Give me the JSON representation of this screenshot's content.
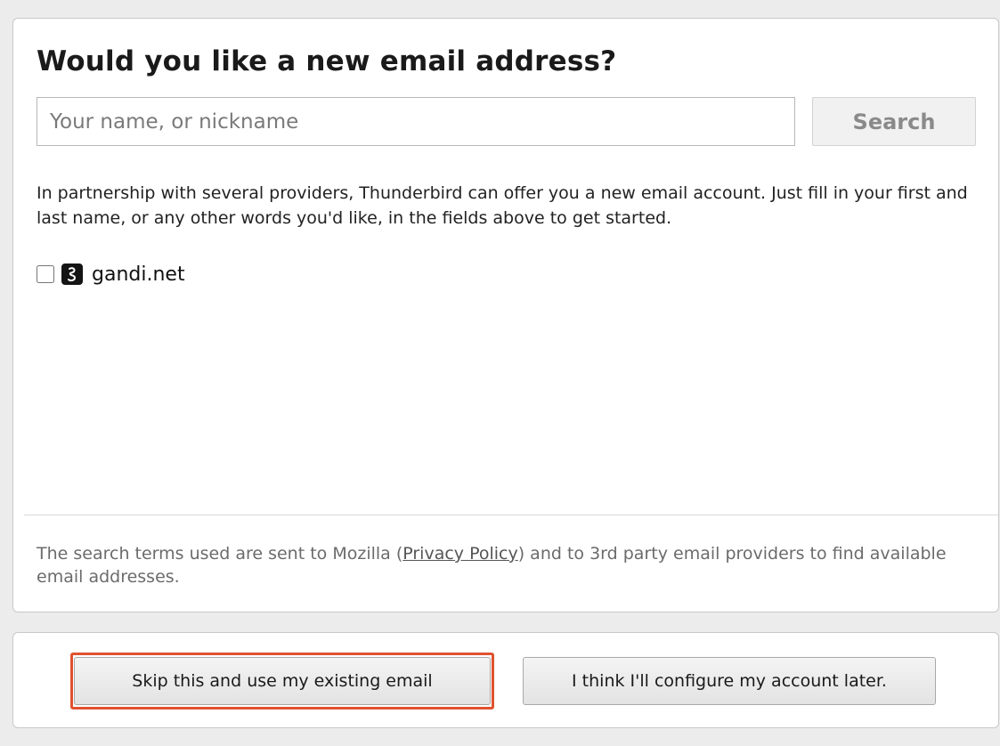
{
  "dialog": {
    "title": "Would you like a new email address?"
  },
  "search": {
    "placeholder": "Your name, or nickname",
    "value": "",
    "button_label": "Search"
  },
  "description": "In partnership with several providers, Thunderbird can offer you a new email account. Just fill in your first and last name, or any other words you'd like, in the fields above to get started.",
  "providers": [
    {
      "label": "gandi.net",
      "icon": "gandi-logo-icon",
      "checked": false
    }
  ],
  "privacy": {
    "text_before": "The search terms used are sent to Mozilla (",
    "link_label": "Privacy Policy",
    "text_after": ") and to 3rd party email providers to find available email addresses."
  },
  "actions": {
    "skip_label": "Skip this and use my existing email",
    "later_label": "I think I'll configure my account later."
  },
  "colors": {
    "highlight": "#e0522f"
  }
}
